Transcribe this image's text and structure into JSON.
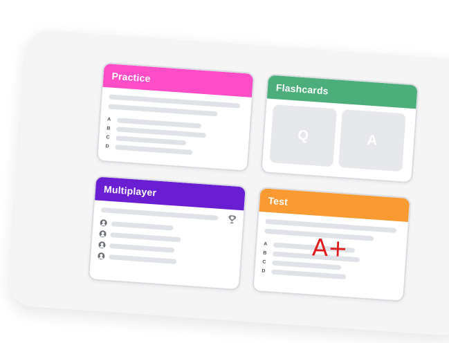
{
  "cards": {
    "practice": {
      "title": "Practice",
      "color": "#ff4dc7",
      "options": [
        "A",
        "B",
        "C",
        "D"
      ]
    },
    "flashcards": {
      "title": "Flashcards",
      "color": "#4cae7a",
      "front": "Q",
      "back": "A"
    },
    "multiplayer": {
      "title": "Multiplayer",
      "color": "#6a1ed1",
      "players_icon": "user-icon",
      "top_icon": "trophy-icon"
    },
    "test": {
      "title": "Test",
      "color": "#f99a33",
      "options": [
        "A",
        "B",
        "C",
        "D"
      ],
      "grade": "A+"
    }
  }
}
